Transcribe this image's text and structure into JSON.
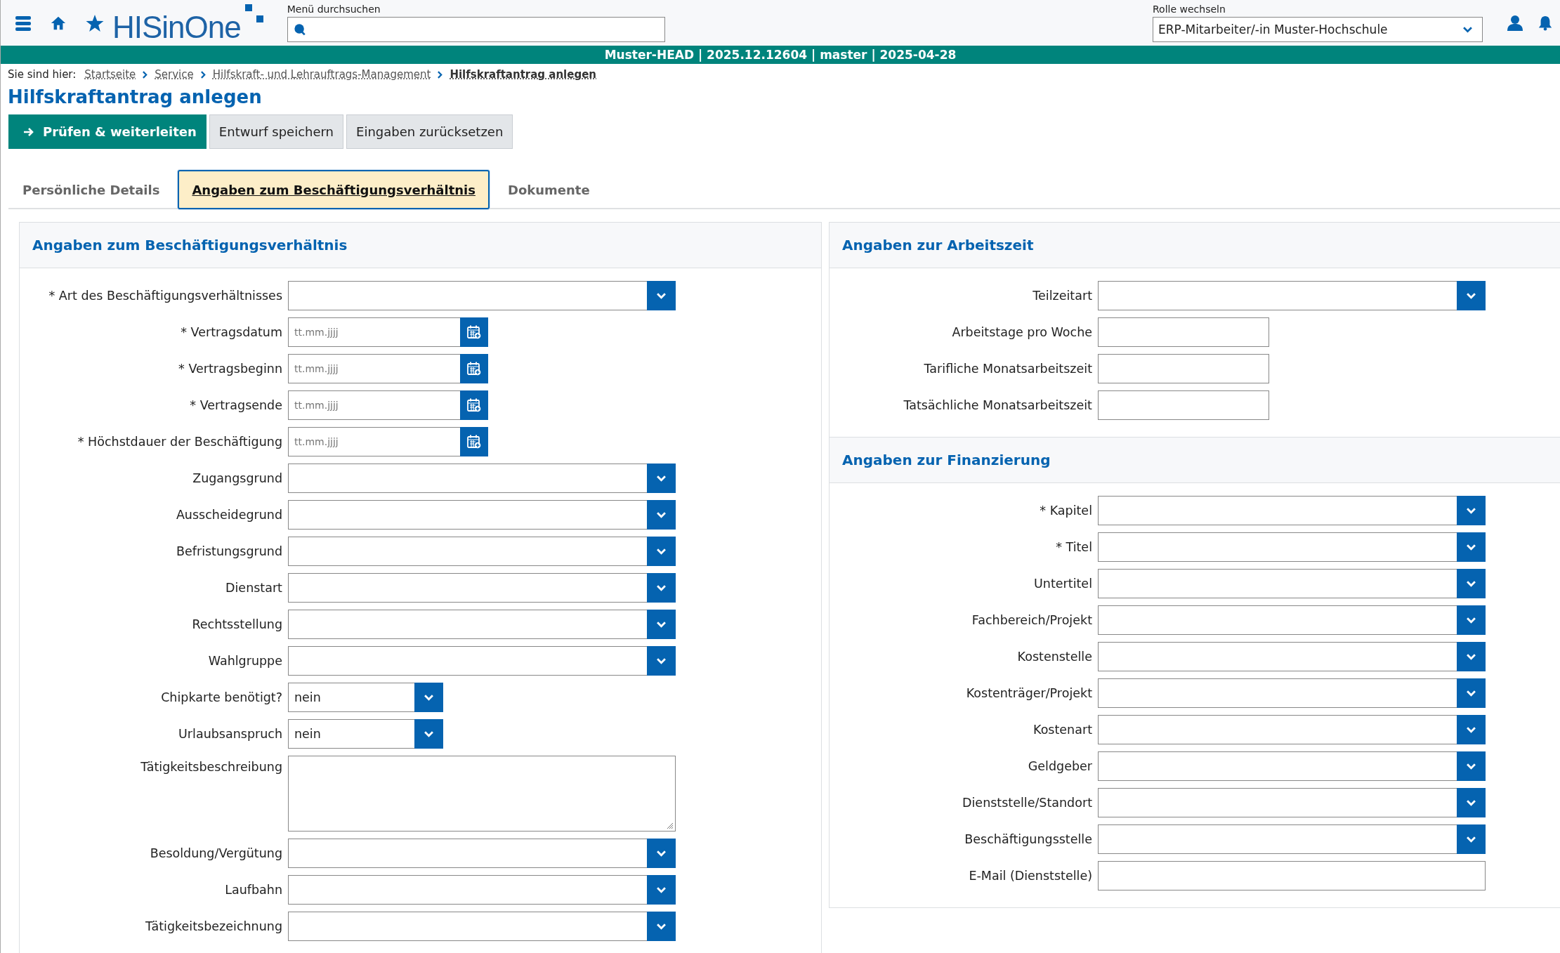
{
  "header": {
    "logo": "HISinOne",
    "search": {
      "label": "Menü durchsuchen"
    },
    "role": {
      "label": "Rolle wechseln",
      "value": "ERP-Mitarbeiter/-in Muster-Hochschule"
    }
  },
  "status_bar": "Muster-HEAD | 2025.12.12604 | master | 2025-04-28",
  "breadcrumb": {
    "label": "Sie sind hier:",
    "items": [
      {
        "text": "Startseite",
        "current": false
      },
      {
        "text": "Service",
        "current": false
      },
      {
        "text": "Hilfskraft- und Lehrauftrags-Management",
        "current": false
      },
      {
        "text": "Hilfskraftantrag anlegen",
        "current": true
      }
    ]
  },
  "title": "Hilfskraftantrag anlegen",
  "actions": [
    {
      "label": "Prüfen & weiterleiten",
      "kind": "primary"
    },
    {
      "label": "Entwurf speichern",
      "kind": "secondary"
    },
    {
      "label": "Eingaben zurücksetzen",
      "kind": "secondary"
    }
  ],
  "tabs": [
    {
      "label": "Persönliche Details",
      "selected": false
    },
    {
      "label": "Angaben zum Beschäftigungsverhältnis",
      "selected": true
    },
    {
      "label": "Dokumente",
      "selected": false
    }
  ],
  "columns": [
    [
      {
        "title": "Angaben zum Beschäftigungsverhältnis",
        "fields": [
          {
            "label": "* Art des Beschäftigungsverhältnisses",
            "kind": "select"
          },
          {
            "label": "* Vertragsdatum",
            "kind": "date",
            "placeholder": "tt.mm.jjjj"
          },
          {
            "label": "* Vertragsbeginn",
            "kind": "date",
            "placeholder": "tt.mm.jjjj"
          },
          {
            "label": "* Vertragsende",
            "kind": "date",
            "placeholder": "tt.mm.jjjj"
          },
          {
            "label": "* Höchstdauer der Beschäftigung",
            "kind": "date",
            "placeholder": "tt.mm.jjjj"
          },
          {
            "label": "Zugangsgrund",
            "kind": "select"
          },
          {
            "label": "Ausscheidegrund",
            "kind": "select"
          },
          {
            "label": "Befristungsgrund",
            "kind": "select"
          },
          {
            "label": "Dienstart",
            "kind": "select"
          },
          {
            "label": "Rechtsstellung",
            "kind": "select"
          },
          {
            "label": "Wahlgruppe",
            "kind": "select"
          },
          {
            "label": "Chipkarte benötigt?",
            "kind": "shortselect",
            "value": "nein"
          },
          {
            "label": "Urlaubsanspruch",
            "kind": "shortselect",
            "value": "nein"
          },
          {
            "label": "Tätigkeitsbeschreibung",
            "kind": "textarea"
          },
          {
            "label": "Besoldung/Vergütung",
            "kind": "select"
          },
          {
            "label": "Laufbahn",
            "kind": "select"
          },
          {
            "label": "Tätigkeitsbezeichnung",
            "kind": "select"
          }
        ]
      }
    ],
    [
      {
        "title": "Angaben zur Arbeitszeit",
        "fields": [
          {
            "label": "Teilzeitart",
            "kind": "select"
          },
          {
            "label": "Arbeitstage pro Woche",
            "kind": "text"
          },
          {
            "label": "Tarifliche Monatsarbeitszeit",
            "kind": "text"
          },
          {
            "label": "Tatsächliche Monatsarbeitszeit",
            "kind": "text"
          }
        ]
      },
      {
        "title": "Angaben zur Finanzierung",
        "fields": [
          {
            "label": "* Kapitel",
            "kind": "select"
          },
          {
            "label": "* Titel",
            "kind": "select"
          },
          {
            "label": "Untertitel",
            "kind": "select"
          },
          {
            "label": "Fachbereich/Projekt",
            "kind": "select"
          },
          {
            "label": "Kostenstelle",
            "kind": "select"
          },
          {
            "label": "Kostenträger/Projekt",
            "kind": "select"
          },
          {
            "label": "Kostenart",
            "kind": "select"
          },
          {
            "label": "Geldgeber",
            "kind": "select"
          },
          {
            "label": "Dienststelle/Standort",
            "kind": "select"
          },
          {
            "label": "Beschäftigungsstelle",
            "kind": "select"
          },
          {
            "label": "E-Mail (Dienststelle)",
            "kind": "wide"
          }
        ]
      }
    ]
  ]
}
